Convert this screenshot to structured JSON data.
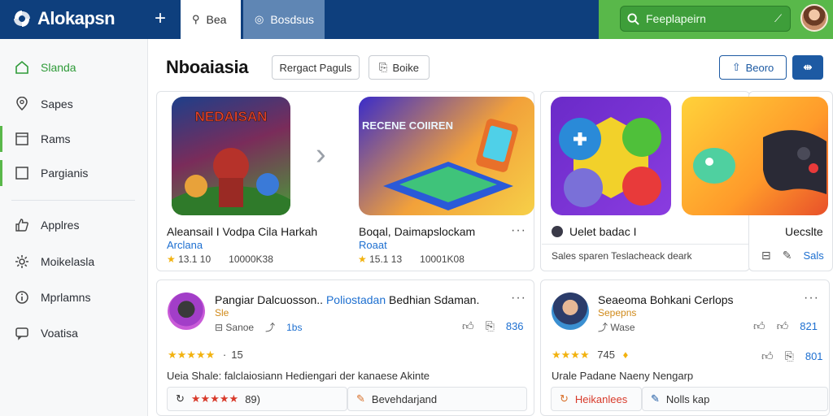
{
  "app": {
    "name": "Alokapsn",
    "tab_active": "Bea",
    "tab_secondary": "Bosdsus",
    "search_placeholder": "Feeplapeirn"
  },
  "sidebar": {
    "items": [
      {
        "label": "Slanda",
        "icon": "home-icon"
      },
      {
        "label": "Sapes",
        "icon": "location-icon"
      },
      {
        "label": "Rams",
        "icon": "square-icon"
      },
      {
        "label": "Pargianis",
        "icon": "square-icon"
      },
      {
        "label": "Applres",
        "icon": "like-icon"
      },
      {
        "label": "Moikelasla",
        "icon": "settings-icon"
      },
      {
        "label": "Mprlamns",
        "icon": "info-icon"
      },
      {
        "label": "Voatisa",
        "icon": "message-icon"
      }
    ]
  },
  "header": {
    "title": "Nboaiasia",
    "btn_filter": "Rergact Paguls",
    "btn_sort": "Boike",
    "btn_record": "Beoro",
    "btn_grid": "⇹"
  },
  "games": [
    {
      "title": "Aleansail I Vodpa Cila Harkah",
      "subtitle": "Arclana",
      "rating": "13.1 10",
      "downloads": "10000K38",
      "art_text": "NEDAISAN"
    },
    {
      "title": "Boqal, Daimapslockam",
      "subtitle": "Roaat",
      "rating": "15.1 13",
      "downloads": "10001K08",
      "art_text": "RECENE COIIREN"
    },
    {
      "title": "Uelet badac I",
      "subtitle": "Sales sparen Teslacheack deark"
    },
    {
      "title": "Uecslte",
      "action": "Sals"
    }
  ],
  "posts": [
    {
      "author": "Pangiar Dalcuosson..",
      "author_link": "Poliostadan",
      "author_rest": "Bedhian Sdaman.",
      "tag": "Sle",
      "action": "Sanoe",
      "count": "1bs",
      "score": "836",
      "stars": "★★★★★",
      "rating_note": "15",
      "text": "Ueia Shale: falclaiosiann Hediengari der kanaese Akinte",
      "box1_stars": "★★★★★",
      "box1_val": "89)",
      "box2": "Bevehdarjand"
    },
    {
      "author": "Seaeoma Bohkani Cerlops",
      "tag": "Sepepns",
      "action": "Wase",
      "score": "821",
      "stars": "★★★★",
      "rating_note": "745",
      "score2": "801",
      "text": "Urale Padane Naeny Nengarp",
      "box1": "Heikanlees",
      "box2": "Nolls kap"
    }
  ]
}
